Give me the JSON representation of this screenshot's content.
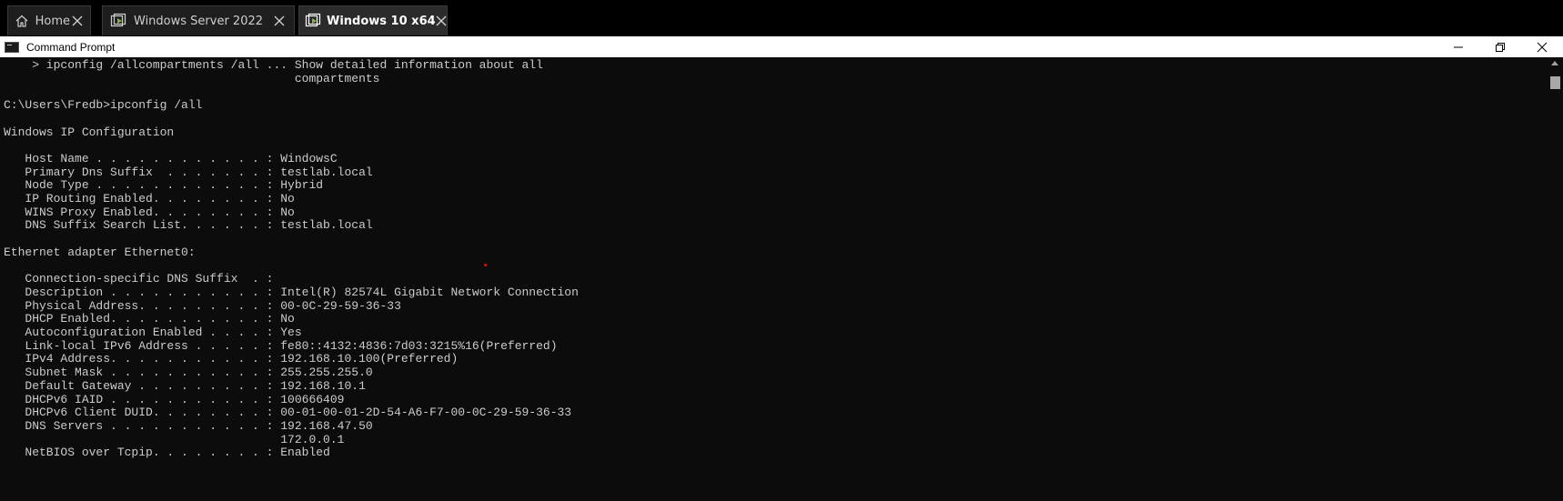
{
  "tabs": [
    {
      "label": "Home",
      "icon": "home-icon",
      "active": false
    },
    {
      "label": "Windows Server 2022",
      "icon": "vm-icon",
      "active": false
    },
    {
      "label": "Windows 10 x64",
      "icon": "vm-icon",
      "active": true
    }
  ],
  "window": {
    "title": "Command Prompt"
  },
  "console": {
    "lines": [
      "    > ipconfig /allcompartments /all ... Show detailed information about all",
      "                                         compartments",
      "",
      "C:\\Users\\Fredb>ipconfig /all",
      "",
      "Windows IP Configuration",
      "",
      "   Host Name . . . . . . . . . . . . : WindowsC",
      "   Primary Dns Suffix  . . . . . . . : testlab.local",
      "   Node Type . . . . . . . . . . . . : Hybrid",
      "   IP Routing Enabled. . . . . . . . : No",
      "   WINS Proxy Enabled. . . . . . . . : No",
      "   DNS Suffix Search List. . . . . . : testlab.local",
      "",
      "Ethernet adapter Ethernet0:",
      "",
      "   Connection-specific DNS Suffix  . :",
      "   Description . . . . . . . . . . . : Intel(R) 82574L Gigabit Network Connection",
      "   Physical Address. . . . . . . . . : 00-0C-29-59-36-33",
      "   DHCP Enabled. . . . . . . . . . . : No",
      "   Autoconfiguration Enabled . . . . : Yes",
      "   Link-local IPv6 Address . . . . . : fe80::4132:4836:7d03:3215%16(Preferred)",
      "   IPv4 Address. . . . . . . . . . . : 192.168.10.100(Preferred)",
      "   Subnet Mask . . . . . . . . . . . : 255.255.255.0",
      "   Default Gateway . . . . . . . . . : 192.168.10.1",
      "   DHCPv6 IAID . . . . . . . . . . . : 100666409",
      "   DHCPv6 Client DUID. . . . . . . . : 00-01-00-01-2D-54-A6-F7-00-0C-29-59-36-33",
      "   DNS Servers . . . . . . . . . . . : 192.168.47.50",
      "                                       172.0.0.1",
      "   NetBIOS over Tcpip. . . . . . . . : Enabled"
    ]
  },
  "colors": {
    "console_bg": "#0c0c0c",
    "console_fg": "#cccccc",
    "vm_icon_green": "#7ab648"
  }
}
